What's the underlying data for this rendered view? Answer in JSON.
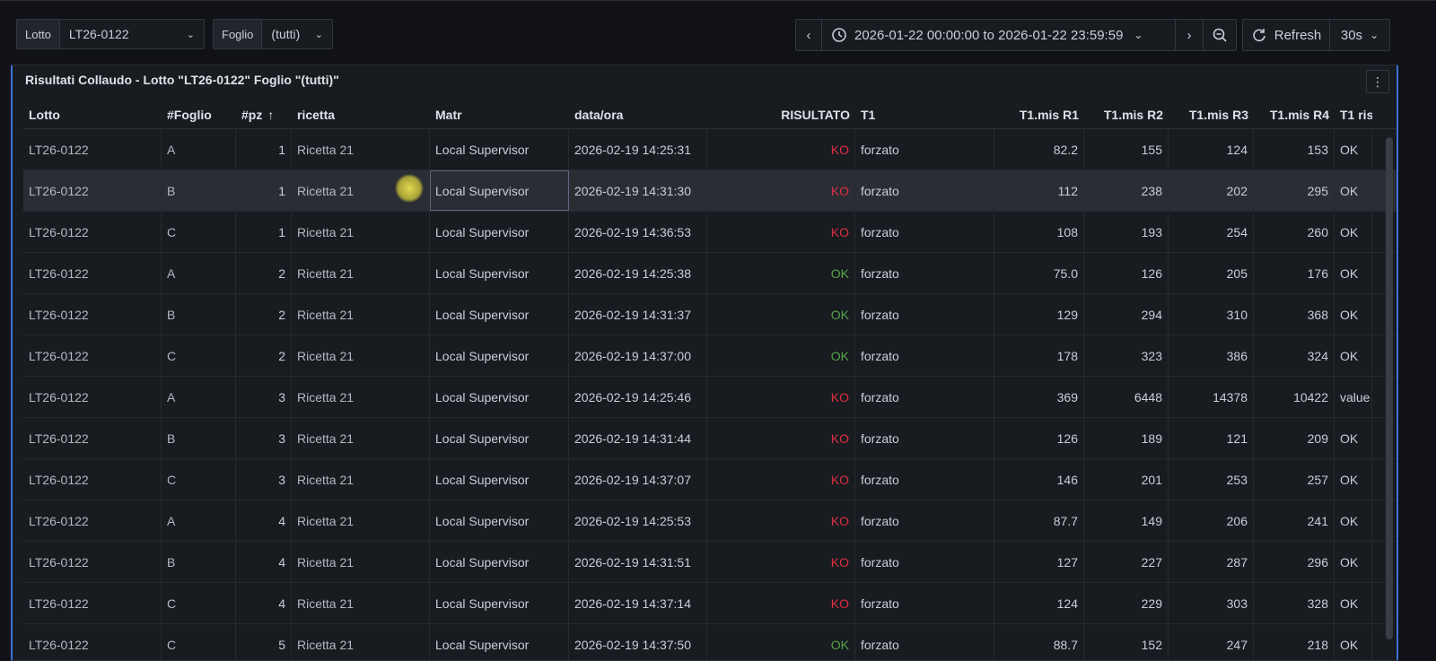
{
  "variables": {
    "lotto": {
      "label": "Lotto",
      "value": "LT26-0122"
    },
    "foglio": {
      "label": "Foglio",
      "value": "(tutti)"
    }
  },
  "timepicker": {
    "range": "2026-01-22 00:00:00 to 2026-01-22 23:59:59",
    "refresh_label": "Refresh",
    "interval": "30s"
  },
  "panel": {
    "title": "Risultati Collaudo - Lotto \"LT26-0122\" Foglio \"(tutti)\""
  },
  "table": {
    "sort_indicator": "↑",
    "columns": [
      "Lotto",
      "#Foglio",
      "#pz",
      "ricetta",
      "Matr",
      "data/ora",
      "RISULTATO",
      "T1",
      "T1.mis R1",
      "T1.mis R2",
      "T1.mis R3",
      "T1.mis R4",
      "T1 ris"
    ],
    "rows": [
      [
        "LT26-0122",
        "A",
        "1",
        "Ricetta 21",
        "Local Supervisor",
        "2026-02-19 14:25:31",
        "KO",
        "forzato",
        "82.2",
        "155",
        "124",
        "153",
        "OK"
      ],
      [
        "LT26-0122",
        "B",
        "1",
        "Ricetta 21",
        "Local Supervisor",
        "2026-02-19 14:31:30",
        "KO",
        "forzato",
        "112",
        "238",
        "202",
        "295",
        "OK"
      ],
      [
        "LT26-0122",
        "C",
        "1",
        "Ricetta 21",
        "Local Supervisor",
        "2026-02-19 14:36:53",
        "KO",
        "forzato",
        "108",
        "193",
        "254",
        "260",
        "OK"
      ],
      [
        "LT26-0122",
        "A",
        "2",
        "Ricetta 21",
        "Local Supervisor",
        "2026-02-19 14:25:38",
        "OK",
        "forzato",
        "75.0",
        "126",
        "205",
        "176",
        "OK"
      ],
      [
        "LT26-0122",
        "B",
        "2",
        "Ricetta 21",
        "Local Supervisor",
        "2026-02-19 14:31:37",
        "OK",
        "forzato",
        "129",
        "294",
        "310",
        "368",
        "OK"
      ],
      [
        "LT26-0122",
        "C",
        "2",
        "Ricetta 21",
        "Local Supervisor",
        "2026-02-19 14:37:00",
        "OK",
        "forzato",
        "178",
        "323",
        "386",
        "324",
        "OK"
      ],
      [
        "LT26-0122",
        "A",
        "3",
        "Ricetta 21",
        "Local Supervisor",
        "2026-02-19 14:25:46",
        "KO",
        "forzato",
        "369",
        "6448",
        "14378",
        "10422",
        "value"
      ],
      [
        "LT26-0122",
        "B",
        "3",
        "Ricetta 21",
        "Local Supervisor",
        "2026-02-19 14:31:44",
        "KO",
        "forzato",
        "126",
        "189",
        "121",
        "209",
        "OK"
      ],
      [
        "LT26-0122",
        "C",
        "3",
        "Ricetta 21",
        "Local Supervisor",
        "2026-02-19 14:37:07",
        "KO",
        "forzato",
        "146",
        "201",
        "253",
        "257",
        "OK"
      ],
      [
        "LT26-0122",
        "A",
        "4",
        "Ricetta 21",
        "Local Supervisor",
        "2026-02-19 14:25:53",
        "KO",
        "forzato",
        "87.7",
        "149",
        "206",
        "241",
        "OK"
      ],
      [
        "LT26-0122",
        "B",
        "4",
        "Ricetta 21",
        "Local Supervisor",
        "2026-02-19 14:31:51",
        "KO",
        "forzato",
        "127",
        "227",
        "287",
        "296",
        "OK"
      ],
      [
        "LT26-0122",
        "C",
        "4",
        "Ricetta 21",
        "Local Supervisor",
        "2026-02-19 14:37:14",
        "KO",
        "forzato",
        "124",
        "229",
        "303",
        "328",
        "OK"
      ],
      [
        "LT26-0122",
        "C",
        "5",
        "Ricetta 21",
        "Local Supervisor",
        "2026-02-19 14:37:50",
        "OK",
        "forzato",
        "88.7",
        "152",
        "247",
        "218",
        "OK"
      ]
    ]
  },
  "colors": {
    "ko": "#e02f44",
    "ok": "#56a64b",
    "accent": "#3d71d9"
  }
}
